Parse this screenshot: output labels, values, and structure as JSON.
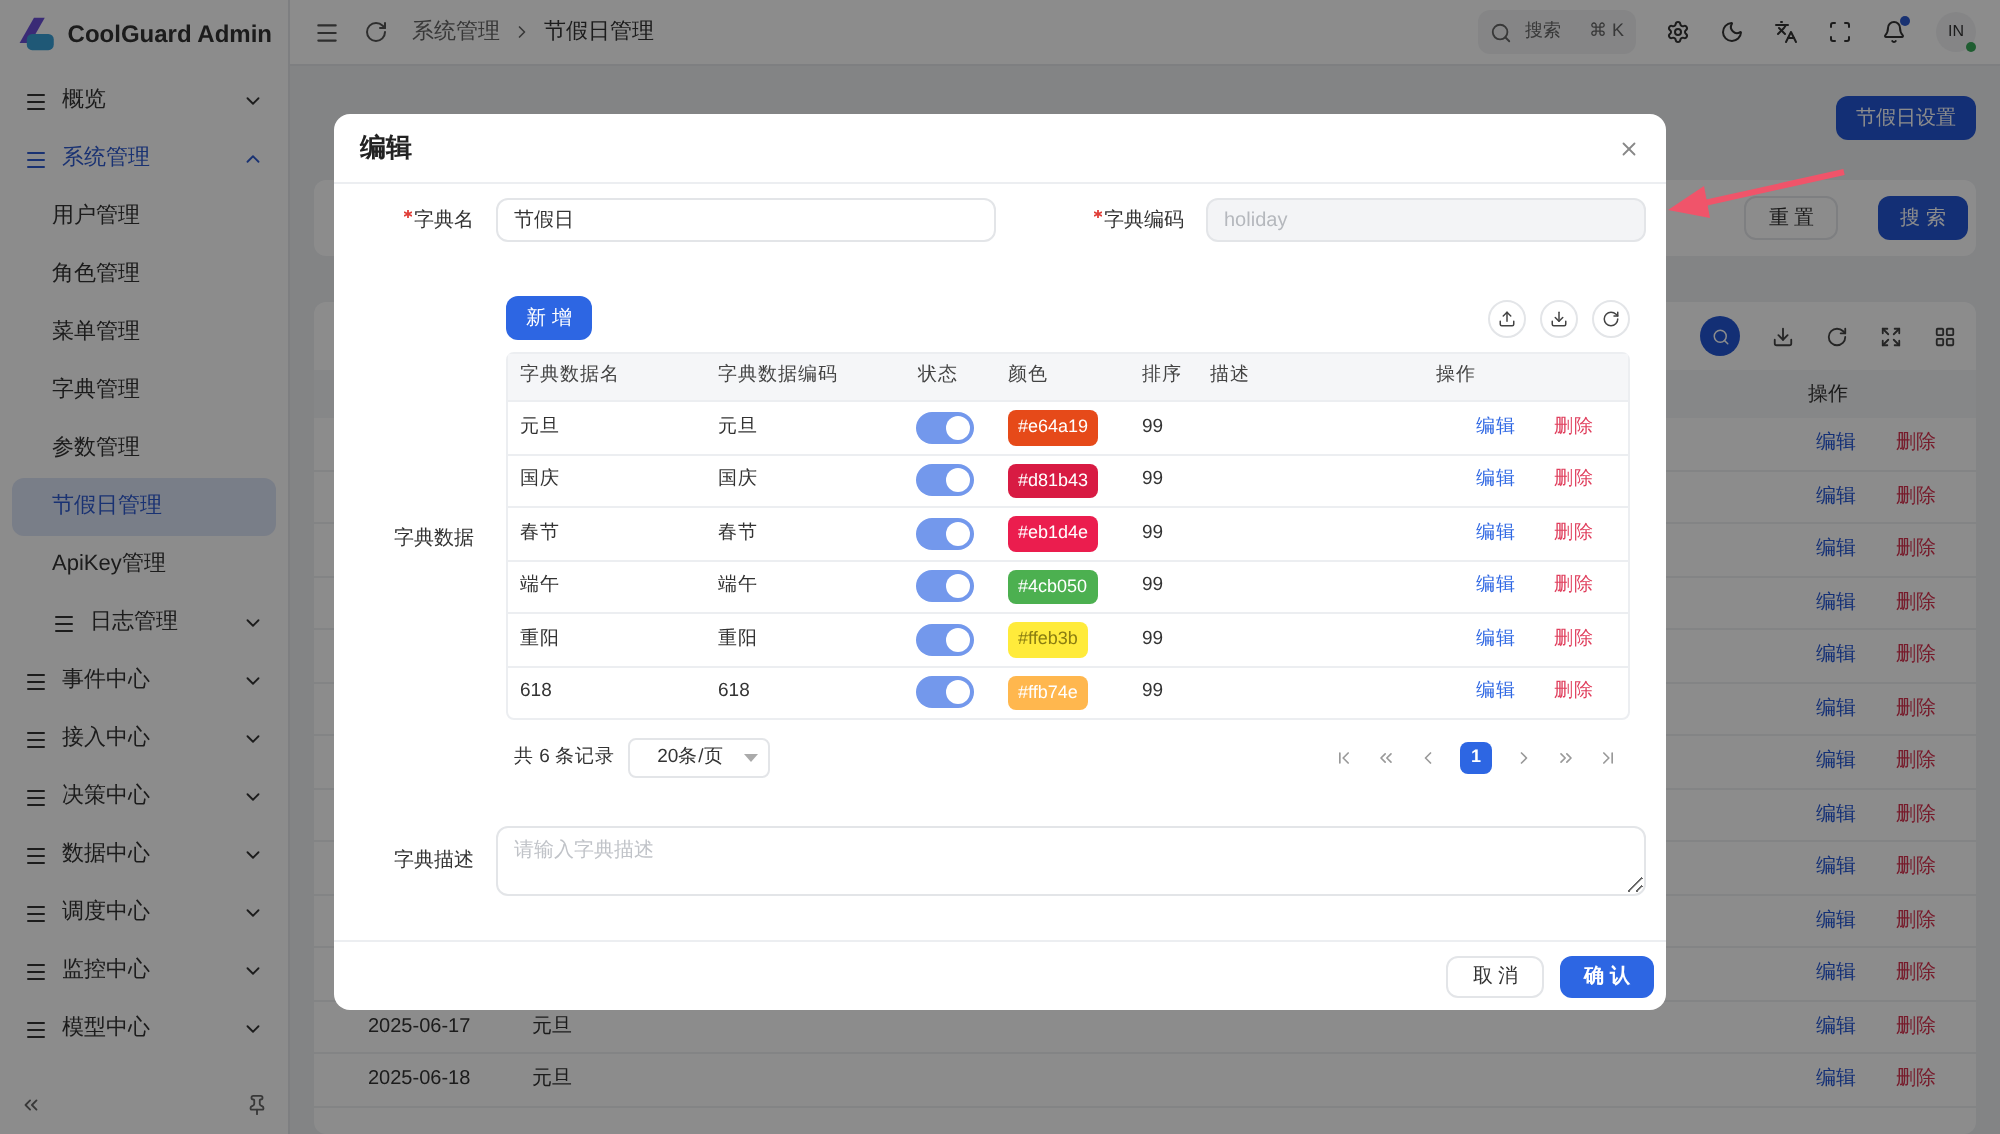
{
  "sidebar": {
    "logo_text": "CoolGuard Admin",
    "items": [
      {
        "label": "概览",
        "kind": "group",
        "expanded": false,
        "selected": false
      },
      {
        "label": "系统管理",
        "kind": "group",
        "expanded": true,
        "selected": true,
        "children": [
          {
            "label": "用户管理",
            "kind": "page",
            "selected": false
          },
          {
            "label": "角色管理",
            "kind": "page",
            "selected": false
          },
          {
            "label": "菜单管理",
            "kind": "page",
            "selected": false
          },
          {
            "label": "字典管理",
            "kind": "page",
            "selected": false
          },
          {
            "label": "参数管理",
            "kind": "page",
            "selected": false
          },
          {
            "label": "节假日管理",
            "kind": "page",
            "selected": true
          },
          {
            "label": "ApiKey管理",
            "kind": "page",
            "selected": false
          },
          {
            "label": "日志管理",
            "kind": "group",
            "expanded": false,
            "selected": false
          }
        ]
      },
      {
        "label": "事件中心",
        "kind": "group",
        "expanded": false,
        "selected": false
      },
      {
        "label": "接入中心",
        "kind": "group",
        "expanded": false,
        "selected": false
      },
      {
        "label": "决策中心",
        "kind": "group",
        "expanded": false,
        "selected": false
      },
      {
        "label": "数据中心",
        "kind": "group",
        "expanded": false,
        "selected": false
      },
      {
        "label": "调度中心",
        "kind": "group",
        "expanded": false,
        "selected": false
      },
      {
        "label": "监控中心",
        "kind": "group",
        "expanded": false,
        "selected": false
      },
      {
        "label": "模型中心",
        "kind": "group",
        "expanded": false,
        "selected": false
      }
    ]
  },
  "header": {
    "breadcrumb": [
      "系统管理",
      "节假日管理"
    ],
    "search": {
      "placeholder": "搜索",
      "shortcut": "⌘ K"
    },
    "notifications_unread": true,
    "avatar": {
      "initials": "IN",
      "online": true
    }
  },
  "page": {
    "settings_button": "节假日设置",
    "reset_button": "重 置",
    "search_button": "搜 索",
    "table": {
      "columns": [
        "操作"
      ],
      "rows": [
        {
          "actions": [
            "编辑",
            "删除"
          ]
        },
        {
          "actions": [
            "编辑",
            "删除"
          ]
        },
        {
          "actions": [
            "编辑",
            "删除"
          ]
        },
        {
          "actions": [
            "编辑",
            "删除"
          ]
        },
        {
          "actions": [
            "编辑",
            "删除"
          ]
        },
        {
          "actions": [
            "编辑",
            "删除"
          ]
        },
        {
          "actions": [
            "编辑",
            "删除"
          ]
        },
        {
          "actions": [
            "编辑",
            "删除"
          ]
        },
        {
          "actions": [
            "编辑",
            "删除"
          ]
        },
        {
          "actions": [
            "编辑",
            "删除"
          ]
        },
        {
          "actions": [
            "编辑",
            "删除"
          ]
        },
        {
          "date": "2025-06-17",
          "name": "元旦",
          "actions": [
            "编辑",
            "删除"
          ]
        },
        {
          "date": "2025-06-18",
          "name": "元旦",
          "actions": [
            "编辑",
            "删除"
          ]
        }
      ]
    }
  },
  "modal": {
    "title": "编辑",
    "fields": [
      {
        "label": "字典名",
        "required": true,
        "value": "节假日",
        "disabled": false
      },
      {
        "label": "字典编码",
        "required": true,
        "value": "holiday",
        "disabled": true
      }
    ],
    "data_label": "字典数据",
    "add_button": "新 增",
    "table": {
      "columns": [
        "字典数据名",
        "字典数据编码",
        "状态",
        "颜色",
        "排序",
        "描述",
        "操作"
      ],
      "rows": [
        {
          "name": "元旦",
          "code": "元旦",
          "on": true,
          "color": "#e64a19",
          "color_label": "#e64a19",
          "sort": "99",
          "actions": [
            "编辑",
            "删除"
          ]
        },
        {
          "name": "国庆",
          "code": "国庆",
          "on": true,
          "color": "#d81b43",
          "color_label": "#d81b43",
          "sort": "99",
          "actions": [
            "编辑",
            "删除"
          ]
        },
        {
          "name": "春节",
          "code": "春节",
          "on": true,
          "color": "#eb1d4e",
          "color_label": "#eb1d4e",
          "sort": "99",
          "actions": [
            "编辑",
            "删除"
          ]
        },
        {
          "name": "端午",
          "code": "端午",
          "on": true,
          "color": "#4cb050",
          "color_label": "#4cb050",
          "sort": "99",
          "actions": [
            "编辑",
            "删除"
          ]
        },
        {
          "name": "重阳",
          "code": "重阳",
          "on": true,
          "color": "#ffeb3b",
          "color_label": "#ffeb3b",
          "sort": "99",
          "actions": [
            "编辑",
            "删除"
          ]
        },
        {
          "name": "618",
          "code": "618",
          "on": true,
          "color": "#ffb74e",
          "color_label": "#ffb74e",
          "sort": "99",
          "actions": [
            "编辑",
            "删除"
          ]
        }
      ]
    },
    "pagination": {
      "total": "共 6 条记录",
      "page_size": "20条/页",
      "pages": [
        {
          "label": "1",
          "selected": true
        }
      ]
    },
    "description": {
      "label": "字典描述",
      "placeholder": "请输入字典描述"
    },
    "buttons": [
      {
        "label": "取 消",
        "kind": "secondary"
      },
      {
        "label": "确 认",
        "kind": "primary"
      }
    ]
  }
}
